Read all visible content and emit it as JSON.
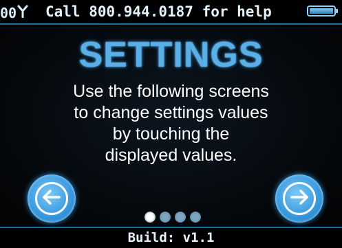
{
  "status_bar": {
    "signal_text": "00",
    "help_text": "Call 800.944.0187 for help",
    "icons": [
      "signal-antenna-icon",
      "battery-icon"
    ],
    "battery_level": 1.0
  },
  "screen": {
    "title": "SETTINGS",
    "body_lines": [
      "Use the following screens",
      "to change settings values",
      "by touching the",
      "displayed values."
    ],
    "prev_button_icon": "arrow-left-icon",
    "next_button_icon": "arrow-right-icon",
    "page_indicator": {
      "total": 4,
      "current": 1
    }
  },
  "footer": {
    "build_text": "Build: v1.1"
  },
  "colors": {
    "accent": "#5ab0e6",
    "button": "#3a9ae0",
    "background": "#05080b",
    "text": "#ffffff"
  }
}
